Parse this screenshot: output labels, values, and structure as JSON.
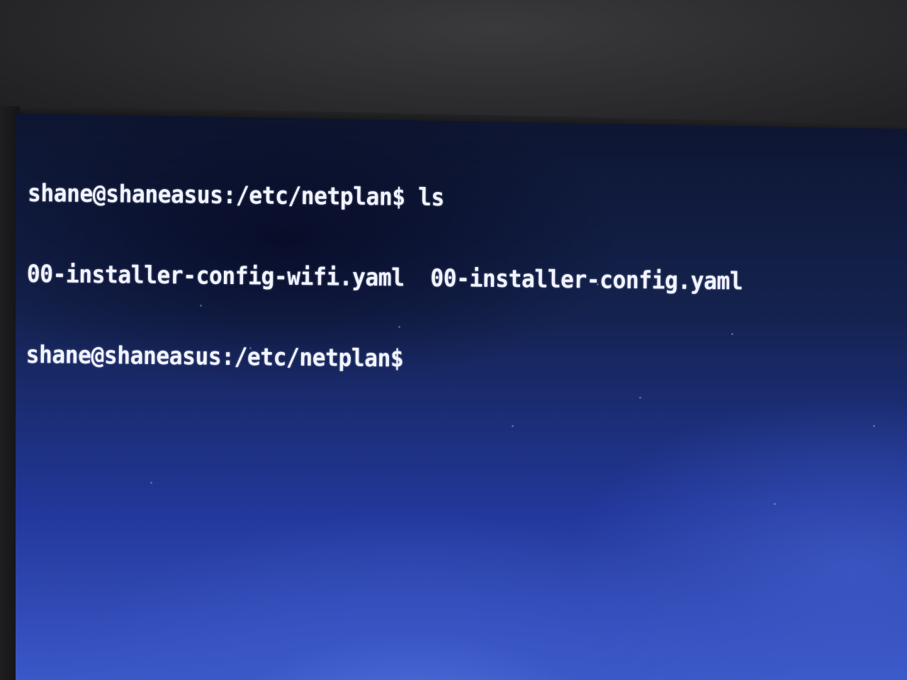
{
  "terminal": {
    "lines": [
      {
        "prompt": "shane@shaneasus:/etc/netplan$",
        "command": " ls"
      },
      {
        "files": [
          "00-installer-config-wifi.yaml",
          "00-installer-config.yaml"
        ]
      },
      {
        "prompt": "shane@shaneasus:/etc/netplan$",
        "command": ""
      }
    ]
  },
  "colors": {
    "text": "#f2f4ff",
    "screen_top": "#0d1530",
    "screen_bottom": "#3b58c8",
    "bezel": "#2a2a2c"
  }
}
